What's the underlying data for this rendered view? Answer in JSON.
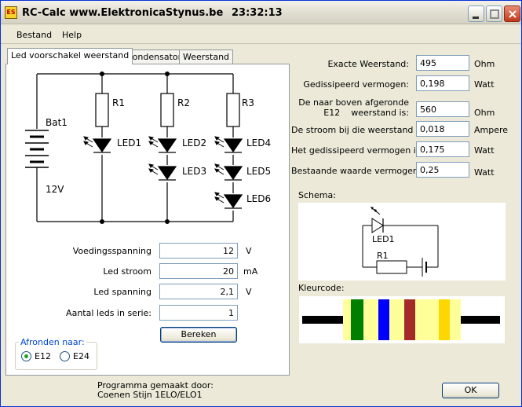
{
  "window": {
    "icon_text": "ES",
    "title": "RC-Calc www.ElektronicaStynus.be",
    "time": "23:32:13"
  },
  "menu": [
    "Bestand",
    "Help"
  ],
  "tabs": [
    "Led voorschakel  weerstand",
    "Condensator",
    "Weerstand"
  ],
  "circuit": {
    "battery_name": "Bat1",
    "battery_voltage": "12V",
    "resistors": [
      "R1",
      "R2",
      "R3"
    ],
    "leds": [
      "LED1",
      "LED2",
      "LED3",
      "LED4",
      "LED5",
      "LED6"
    ]
  },
  "inputs": {
    "voedingsspanning": {
      "label": "Voedingsspanning",
      "value": "12",
      "unit": "V"
    },
    "led_stroom": {
      "label": "Led stroom",
      "value": "20",
      "unit": "mA"
    },
    "led_spanning": {
      "label": "Led spanning",
      "value": "2,1",
      "unit": "V"
    },
    "aantal_leds": {
      "label": "Aantal leds in serie:",
      "value": "1"
    }
  },
  "bereken_label": "Bereken",
  "afronden": {
    "legend": "Afronden naar:",
    "options": [
      "E12",
      "E24"
    ],
    "selected": "E12"
  },
  "results": {
    "exacte_weerstand": {
      "label": "Exacte Weerstand:",
      "value": "495",
      "unit": "Ohm"
    },
    "gedissipeerd": {
      "label": "Gedissipeerd vermogen:",
      "value": "0,198",
      "unit": "Watt"
    },
    "e12_line1": "De naar boven afgeronde",
    "e12_line2": "E12    weerstand is:",
    "e12_value": "560",
    "e12_unit": "Ohm",
    "stroom": {
      "label": "De stroom bij die weerstand is:",
      "value": "0,018",
      "unit": "Ampere"
    },
    "gedissipeerd2": {
      "label": "Het gedissipeerd vermogen is:",
      "value": "0,175",
      "unit": "Watt"
    },
    "bestaande": {
      "label": "Bestaande waarde vermogen:",
      "value": "0,25",
      "unit": "Watt"
    }
  },
  "schema": {
    "label": "Schema:",
    "led": "LED1",
    "resistor": "R1"
  },
  "kleurcode": {
    "label": "Kleurcode:",
    "bands": [
      "#008000",
      "#0000ff",
      "#a52a2a",
      "#ffd700"
    ],
    "body_color": "#ffff99"
  },
  "credits": {
    "line1": "Programma gemaakt door:",
    "line2": "Coenen Stijn 1ELO/ELO1"
  },
  "ok_label": "OK"
}
